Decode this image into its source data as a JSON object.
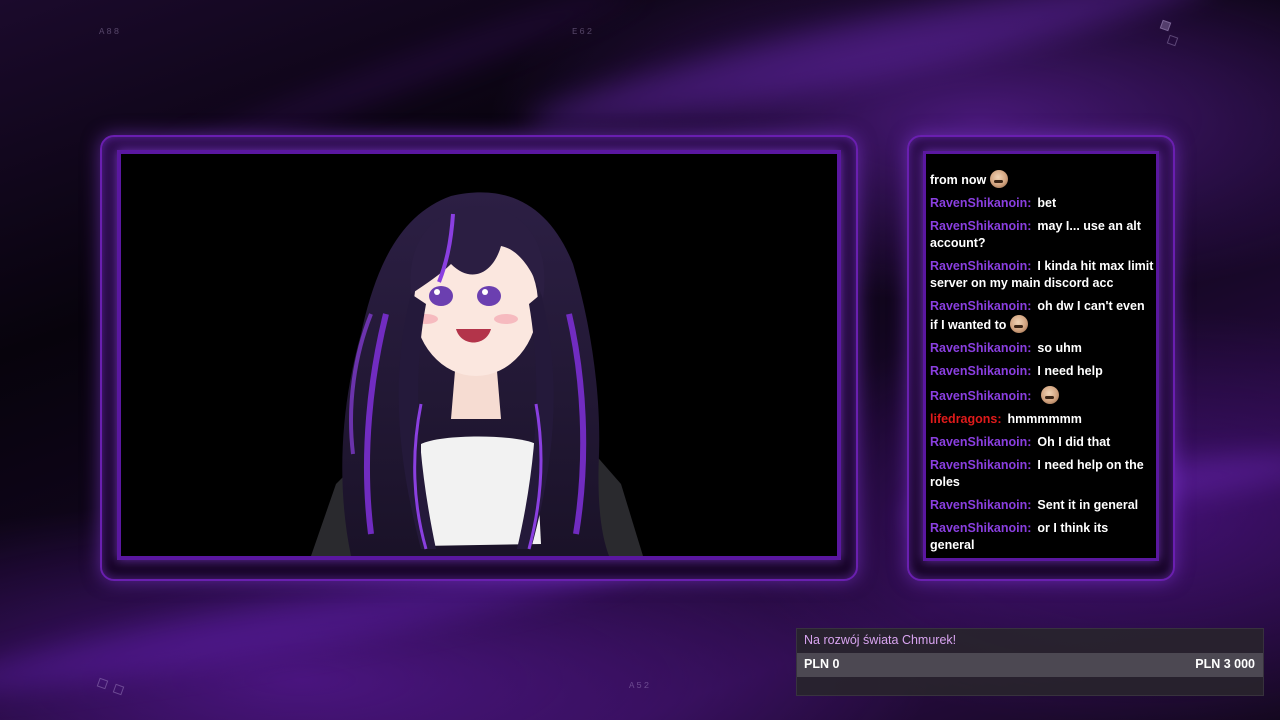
{
  "overlay": {
    "codes": {
      "top_left": "A88",
      "top_center": "E62",
      "bottom_center": "A52"
    }
  },
  "webcam": {
    "avatar_name": "vtuber-avatar"
  },
  "chat": {
    "messages": [
      {
        "user": "",
        "text": "from now",
        "emote": true,
        "color": "#ffffff"
      },
      {
        "user": "RavenShikanoin:",
        "text": "bet",
        "emote": false,
        "color": "#8a3fe0"
      },
      {
        "user": "RavenShikanoin:",
        "text": "may I... use an alt account?",
        "emote": false,
        "color": "#8a3fe0"
      },
      {
        "user": "RavenShikanoin:",
        "text": "I kinda hit max limit server on my main discord acc",
        "emote": false,
        "color": "#8a3fe0"
      },
      {
        "user": "RavenShikanoin:",
        "text": "oh dw I can't even if I wanted to",
        "emote": true,
        "color": "#8a3fe0"
      },
      {
        "user": "RavenShikanoin:",
        "text": "so uhm",
        "emote": false,
        "color": "#8a3fe0"
      },
      {
        "user": "RavenShikanoin:",
        "text": "I need help",
        "emote": false,
        "color": "#8a3fe0"
      },
      {
        "user": "RavenShikanoin:",
        "text": "",
        "emote": true,
        "color": "#8a3fe0"
      },
      {
        "user": "lifedragons:",
        "text": "hmmmmmm",
        "emote": false,
        "color": "#e01b1b"
      },
      {
        "user": "RavenShikanoin:",
        "text": "Oh I did that",
        "emote": false,
        "color": "#8a3fe0"
      },
      {
        "user": "RavenShikanoin:",
        "text": "I need help on the roles",
        "emote": false,
        "color": "#8a3fe0"
      },
      {
        "user": "RavenShikanoin:",
        "text": "Sent it in general",
        "emote": false,
        "color": "#8a3fe0"
      },
      {
        "user": "RavenShikanoin:",
        "text": "or I think its general",
        "emote": false,
        "color": "#8a3fe0"
      }
    ]
  },
  "goal": {
    "title": "Na rozwój świata Chmurek!",
    "current": "PLN 0",
    "target": "PLN 3 000",
    "progress": 0
  },
  "colors": {
    "accent": "#8a3fe0",
    "frame": "#6a1fb0",
    "alert_user": "#e01b1b"
  }
}
